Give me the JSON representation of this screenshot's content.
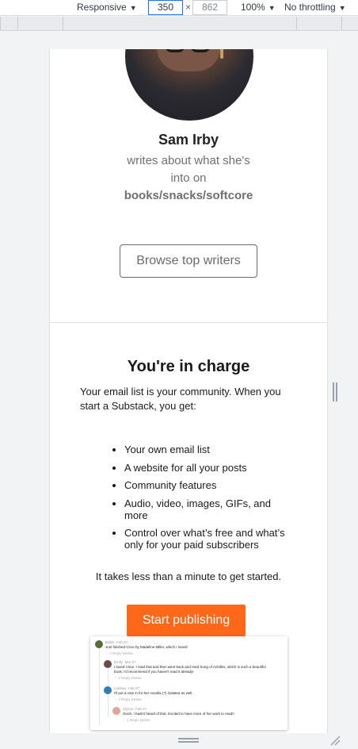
{
  "devtools": {
    "device_label": "Responsive",
    "width_value": "350",
    "height_value": "862",
    "times_glyph": "×",
    "zoom_label": "100%",
    "throttling_label": "No throttling",
    "caret_glyph": "▼"
  },
  "profile": {
    "name": "Sam Irby",
    "desc_line1": "writes about what she's",
    "desc_line2": "into on",
    "topic": "books/snacks/softcore"
  },
  "browse_button_label": "Browse top writers",
  "charge": {
    "title": "You're in charge",
    "intro": "Your email list is your community. When you start a Substack, you get:",
    "features": [
      "Your own email list",
      "A website for all your posts",
      "Community features",
      "Audio, video, images, GIFs, and more",
      "Control over what’s free and what’s only for your paid subscribers"
    ],
    "quick_note": "It takes less than a minute to get started.",
    "start_button_label": "Start publishing"
  },
  "thread_preview": {
    "comments": [
      {
        "author": "Bobbi",
        "date": "Feb 27",
        "text": "Just finished Circe by Madeline Miller, which I loved!",
        "actions": "♡ 3    Reply    Delete",
        "color": "#5a6b3a"
      },
      {
        "author": "Emily",
        "date": "Mar 27",
        "text": "I loved Circe, I read that and then went back and read Song of Achilles, which is such a beautiful",
        "text2": "book, I'd recommend if you haven't read it already!",
        "actions": "♡ 3    Reply    Delete",
        "color": "#6a4a48"
      },
      {
        "author": "Lindsey",
        "date": "Feb 27",
        "text": "I'll put a vote in for her novella (?) Galatea as well.",
        "actions": "♡ 3    Reply    Delete",
        "color": "#2f7fb5"
      },
      {
        "author": "Alyson",
        "date": "Feb 27",
        "text": "Oooh, I hadn't heard of that. Excited to have more of her work to read!!",
        "actions": "♡ 1    Reply    Delete",
        "color": "#e0a5a0"
      }
    ]
  }
}
